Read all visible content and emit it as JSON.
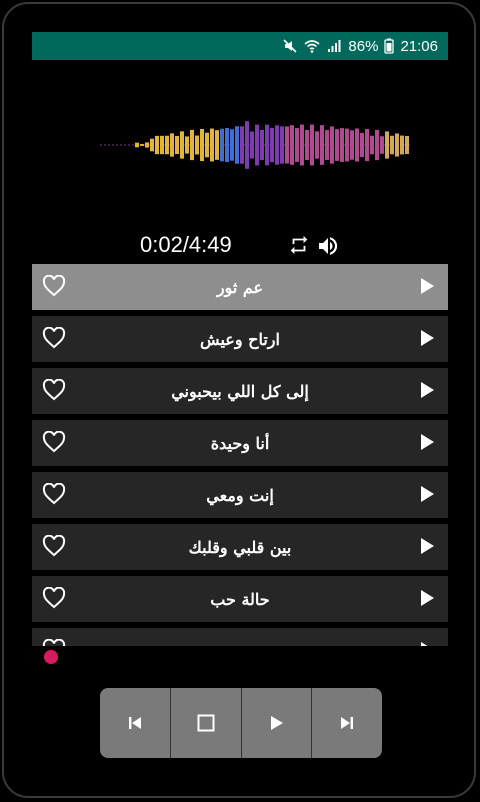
{
  "status": {
    "battery": "86%",
    "time": "21:06"
  },
  "player": {
    "time_display": "0:02/4:49"
  },
  "songs": [
    {
      "title": "عم ثور"
    },
    {
      "title": "ارتاح وعيش"
    },
    {
      "title": "إلى كل اللي بيحبوني"
    },
    {
      "title": "أنا وحيدة"
    },
    {
      "title": "إنت ومعي"
    },
    {
      "title": "بين قلبي وقلبك"
    },
    {
      "title": "حالة حب"
    },
    {
      "title": ""
    }
  ],
  "colors": {
    "status_bar": "#00695c",
    "active_row": "#8e8e8e",
    "row": "#262626",
    "accent_dot": "#d81b60",
    "controls_bg": "#7a7a7a"
  },
  "icons": {
    "repeat": "repeat-icon",
    "volume": "volume-icon",
    "favorite": "heart-outline-icon",
    "play_row": "play-icon",
    "prev": "skip-previous-icon",
    "stop": "stop-icon",
    "play": "play-icon",
    "next": "skip-next-icon"
  }
}
